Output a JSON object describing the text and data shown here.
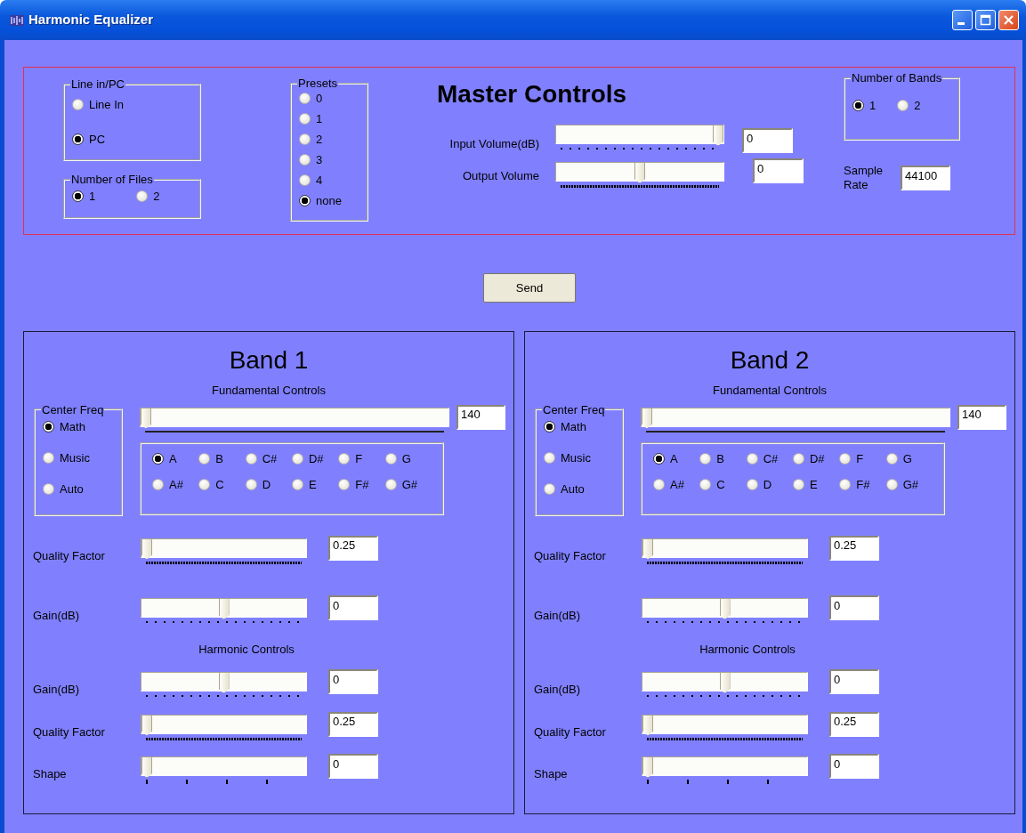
{
  "window": {
    "title": "Harmonic Equalizer"
  },
  "master": {
    "title": "Master Controls",
    "line_in_pc": {
      "label": "Line in/PC",
      "options": [
        {
          "label": "Line In",
          "selected": false
        },
        {
          "label": "PC",
          "selected": true
        }
      ]
    },
    "number_of_files": {
      "label": "Number of Files",
      "options": [
        {
          "label": "1",
          "selected": true
        },
        {
          "label": "2",
          "selected": false
        }
      ]
    },
    "presets": {
      "label": "Presets",
      "options": [
        {
          "label": "0",
          "selected": false
        },
        {
          "label": "1",
          "selected": false
        },
        {
          "label": "2",
          "selected": false
        },
        {
          "label": "3",
          "selected": false
        },
        {
          "label": "4",
          "selected": false
        },
        {
          "label": "none",
          "selected": true
        }
      ]
    },
    "sliders": [
      {
        "label": "Input Volume(dB)",
        "level": 1,
        "value": "0",
        "kind": "dotted"
      },
      {
        "label": "Output Volume",
        "level": 0.5,
        "value": "0",
        "kind": "dense"
      }
    ],
    "number_of_bands": {
      "label": "Number of Bands",
      "options": [
        {
          "label": "1",
          "selected": true
        },
        {
          "label": "2",
          "selected": false
        }
      ]
    },
    "sample_rate": {
      "label": "Sample Rate",
      "value": "44100"
    }
  },
  "send_button": "Send",
  "bands": [
    {
      "title": "Band 1",
      "fundamental_heading": "Fundamental Controls",
      "center_freq": {
        "label": "Center Freq",
        "options": [
          {
            "label": "Math",
            "selected": true
          },
          {
            "label": "Music",
            "selected": false
          },
          {
            "label": "Auto",
            "selected": false
          }
        ]
      },
      "frequency_slider": {
        "level": 0,
        "value": "140",
        "kind": "solid"
      },
      "notes": [
        {
          "label": "A",
          "selected": true
        },
        {
          "label": "B",
          "selected": false
        },
        {
          "label": "C#",
          "selected": false
        },
        {
          "label": "D#",
          "selected": false
        },
        {
          "label": "F",
          "selected": false
        },
        {
          "label": "G",
          "selected": false
        },
        {
          "label": "A#",
          "selected": false
        },
        {
          "label": "C",
          "selected": false
        },
        {
          "label": "D",
          "selected": false
        },
        {
          "label": "E",
          "selected": false
        },
        {
          "label": "F#",
          "selected": false
        },
        {
          "label": "G#",
          "selected": false
        }
      ],
      "fundamental_sliders": [
        {
          "label": "Quality Factor",
          "level": 0,
          "value": "0.25",
          "kind": "dense"
        },
        {
          "label": "Gain(dB)",
          "level": 0.5,
          "value": "0",
          "kind": "dotted"
        }
      ],
      "harmonic_heading": "Harmonic Controls",
      "harmonic_sliders": [
        {
          "label": "Gain(dB)",
          "level": 0.5,
          "value": "0",
          "kind": "dotted"
        },
        {
          "label": "Quality Factor",
          "level": 0,
          "value": "0.25",
          "kind": "dense"
        },
        {
          "label": "Shape",
          "level": 0,
          "value": "0",
          "kind": "sparse"
        }
      ]
    },
    {
      "title": "Band 2",
      "fundamental_heading": "Fundamental Controls",
      "center_freq": {
        "label": "Center Freq",
        "options": [
          {
            "label": "Math",
            "selected": true
          },
          {
            "label": "Music",
            "selected": false
          },
          {
            "label": "Auto",
            "selected": false
          }
        ]
      },
      "frequency_slider": {
        "level": 0,
        "value": "140",
        "kind": "solid"
      },
      "notes": [
        {
          "label": "A",
          "selected": true
        },
        {
          "label": "B",
          "selected": false
        },
        {
          "label": "C#",
          "selected": false
        },
        {
          "label": "D#",
          "selected": false
        },
        {
          "label": "F",
          "selected": false
        },
        {
          "label": "G",
          "selected": false
        },
        {
          "label": "A#",
          "selected": false
        },
        {
          "label": "C",
          "selected": false
        },
        {
          "label": "D",
          "selected": false
        },
        {
          "label": "E",
          "selected": false
        },
        {
          "label": "F#",
          "selected": false
        },
        {
          "label": "G#",
          "selected": false
        }
      ],
      "fundamental_sliders": [
        {
          "label": "Quality Factor",
          "level": 0,
          "value": "0.25",
          "kind": "dense"
        },
        {
          "label": "Gain(dB)",
          "level": 0.5,
          "value": "0",
          "kind": "dotted"
        }
      ],
      "harmonic_heading": "Harmonic Controls",
      "harmonic_sliders": [
        {
          "label": "Gain(dB)",
          "level": 0.5,
          "value": "0",
          "kind": "dotted"
        },
        {
          "label": "Quality Factor",
          "level": 0,
          "value": "0.25",
          "kind": "dense"
        },
        {
          "label": "Shape",
          "level": 0,
          "value": "0",
          "kind": "sparse"
        }
      ]
    }
  ]
}
